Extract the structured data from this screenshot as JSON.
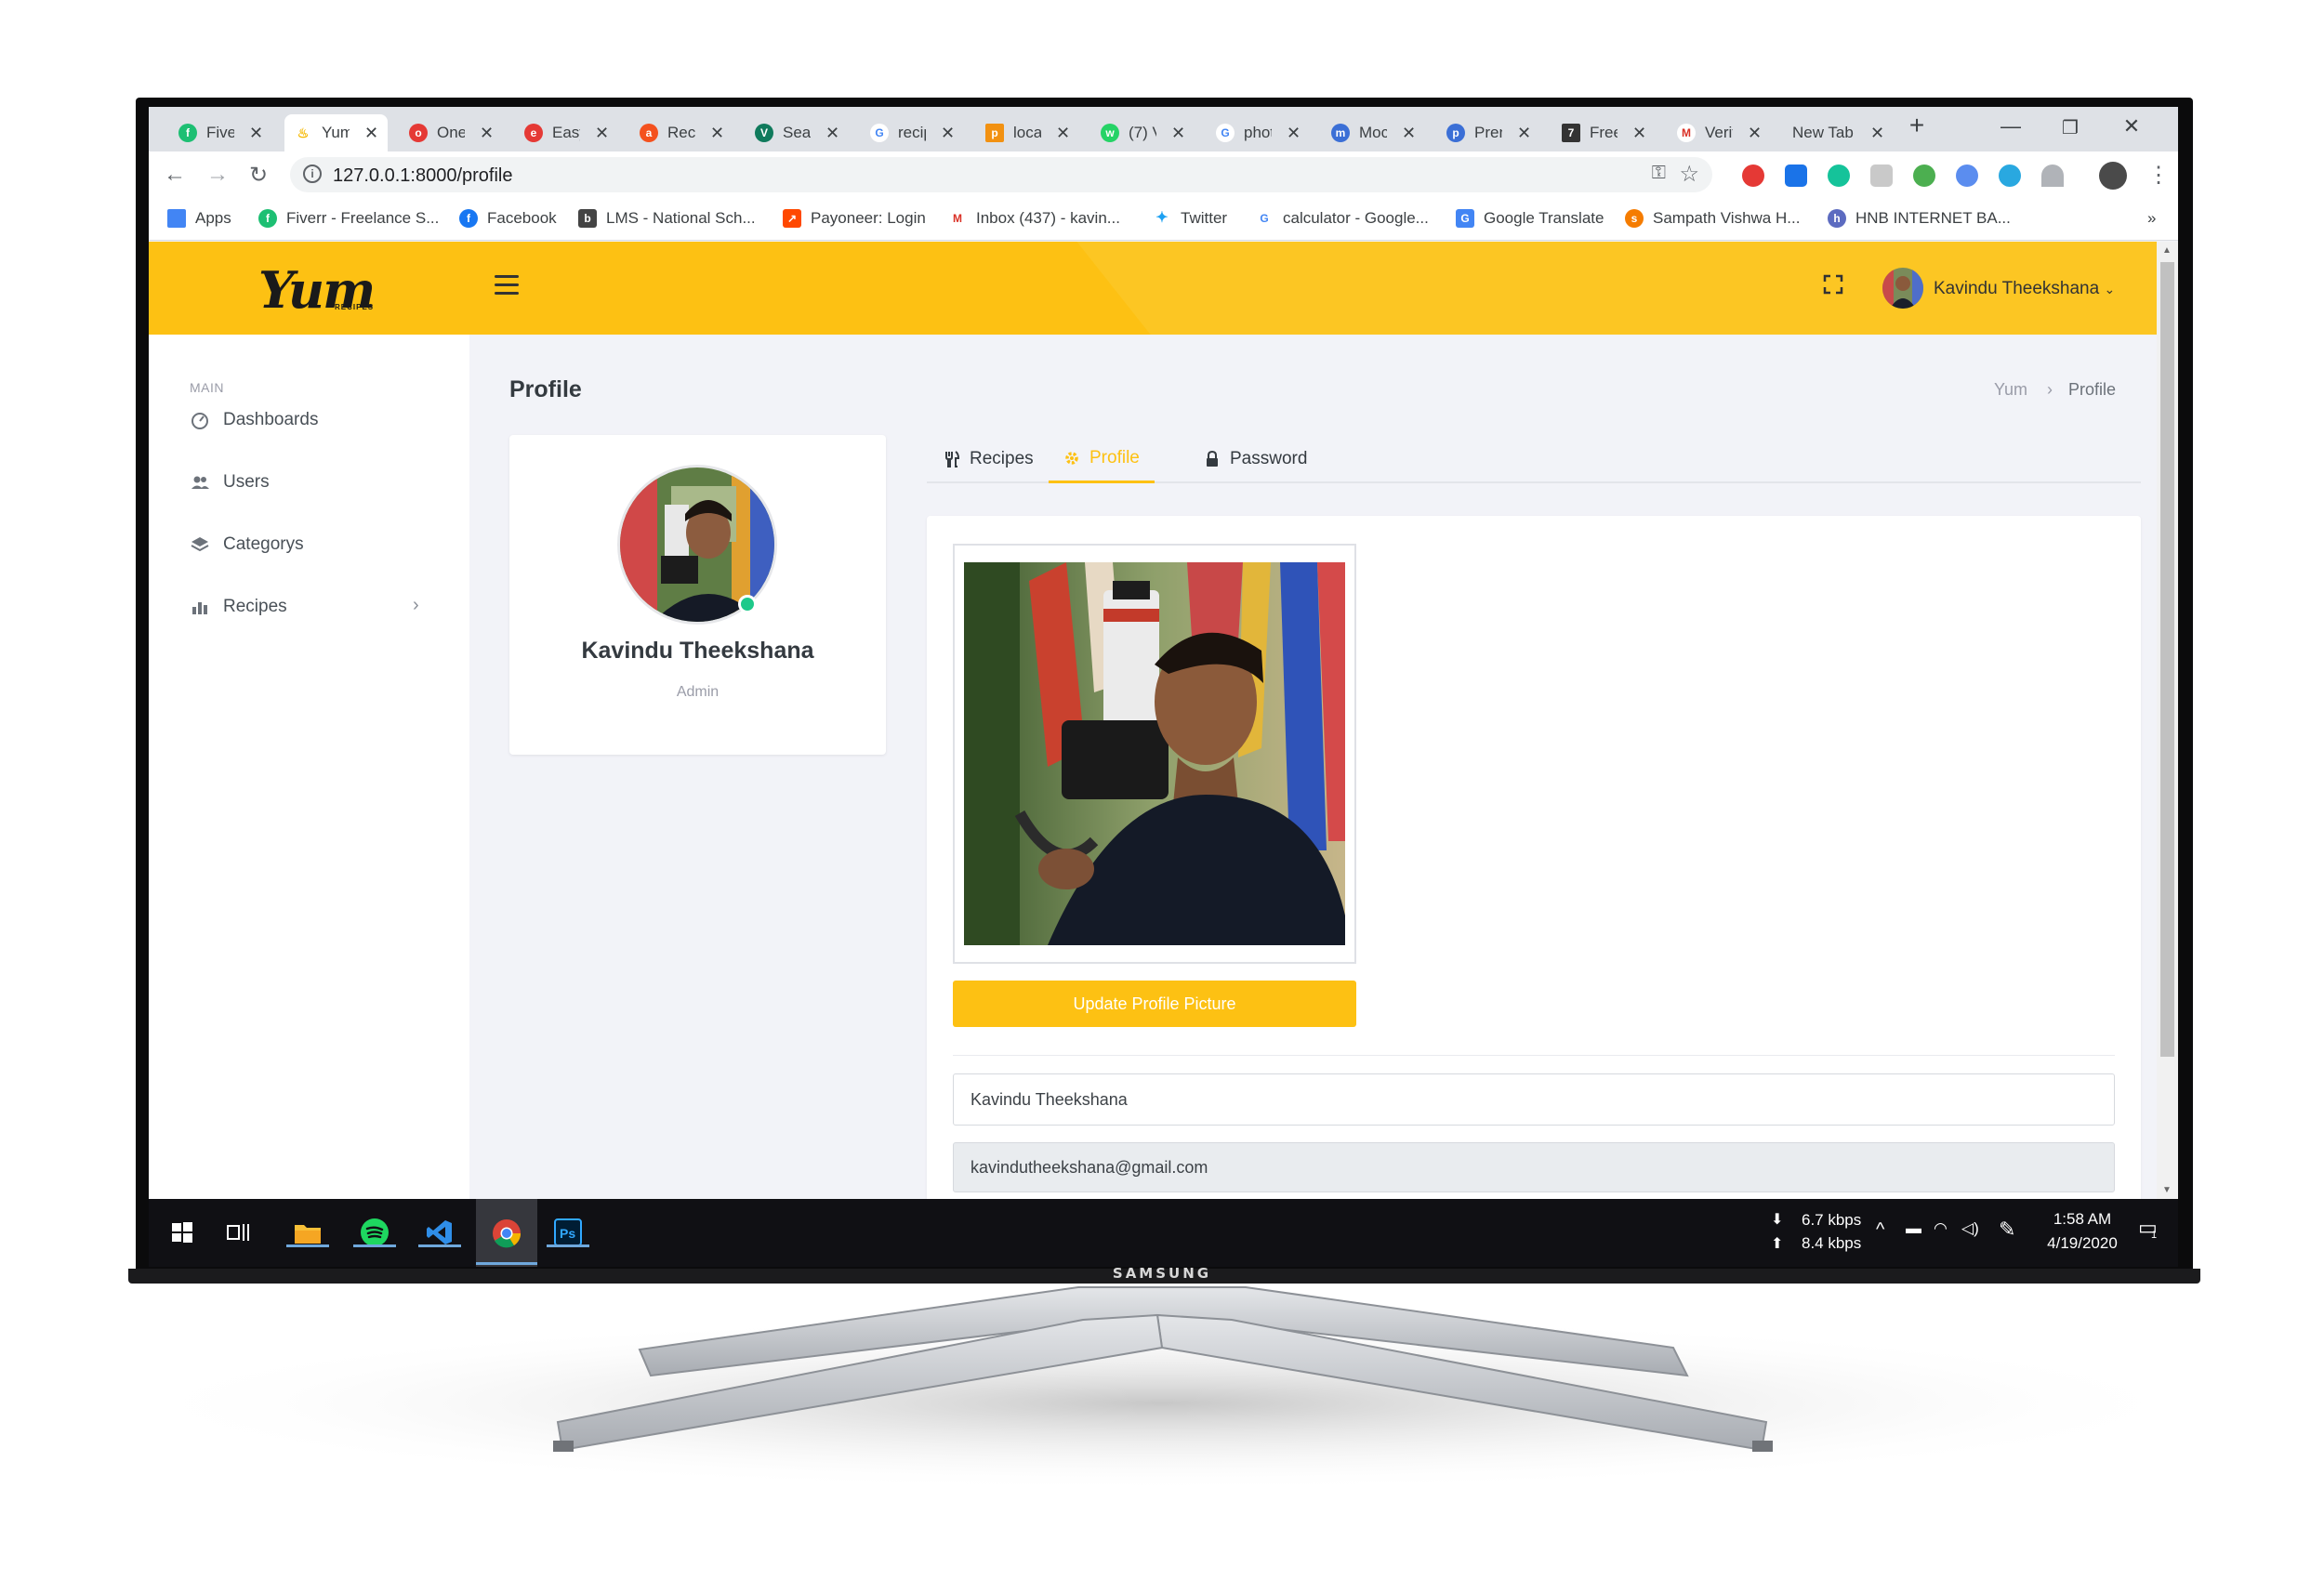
{
  "browser": {
    "tabs": [
      {
        "title": "Fiverr",
        "icon": "fiverr-icon",
        "color": "#1dbf73"
      },
      {
        "title": "Yum",
        "icon": "yum-icon",
        "color": "#f5b800"
      },
      {
        "title": "One",
        "icon": "one-icon",
        "color": "#e53935"
      },
      {
        "title": "Easy",
        "icon": "easy-icon",
        "color": "#e53935"
      },
      {
        "title": "Reci",
        "icon": "recipe-icon",
        "color": "#f4511e"
      },
      {
        "title": "Sear",
        "icon": "search-v-icon",
        "color": "#0f7a5c"
      },
      {
        "title": "recip",
        "icon": "google-icon",
        "color": "#4285f4"
      },
      {
        "title": "local",
        "icon": "pma-icon",
        "color": "#f29111"
      },
      {
        "title": "(7) V",
        "icon": "whatsapp-icon",
        "color": "#25d366"
      },
      {
        "title": "phot",
        "icon": "google-icon",
        "color": "#4285f4"
      },
      {
        "title": "Moc",
        "icon": "mockup-icon",
        "color": "#3b6fd6"
      },
      {
        "title": "Pren",
        "icon": "premium-icon",
        "color": "#3b6fd6"
      },
      {
        "title": "Free",
        "icon": "free-icon",
        "color": "#333333"
      },
      {
        "title": "Verif",
        "icon": "gmail-icon",
        "color": "#d93025"
      },
      {
        "title": "New Tab",
        "icon": "",
        "color": ""
      }
    ],
    "url": "127.0.0.1:8000/profile",
    "bookmarks": [
      {
        "label": "Apps",
        "color": "#4285f4"
      },
      {
        "label": "Fiverr - Freelance S...",
        "color": "#1dbf73"
      },
      {
        "label": "Facebook",
        "color": "#1877f2"
      },
      {
        "label": "LMS - National Sch...",
        "color": "#444444"
      },
      {
        "label": "Payoneer: Login",
        "color": "#ff4800"
      },
      {
        "label": "Inbox (437) - kavin...",
        "color": "#d93025"
      },
      {
        "label": "Twitter",
        "color": "#1da1f2"
      },
      {
        "label": "calculator - Google...",
        "color": "#4285f4"
      },
      {
        "label": "Google Translate",
        "color": "#4285f4"
      },
      {
        "label": "Sampath Vishwa H...",
        "color": "#f57c00"
      },
      {
        "label": "HNB INTERNET BA...",
        "color": "#5c6bc0"
      }
    ],
    "bookmarks_more": "»"
  },
  "app": {
    "logo": "Yum",
    "logo_sub": "RECIPES",
    "header_user": "Kavindu Theekshana",
    "accent": "#fdc113",
    "sidebar": {
      "section": "MAIN",
      "items": [
        {
          "label": "Dashboards",
          "icon": "gauge-icon"
        },
        {
          "label": "Users",
          "icon": "users-icon"
        },
        {
          "label": "Categorys",
          "icon": "layers-icon"
        },
        {
          "label": "Recipes",
          "icon": "chart-icon"
        }
      ]
    },
    "page_title": "Profile",
    "breadcrumb": [
      "Yum",
      "Profile"
    ],
    "profile_card": {
      "name": "Kavindu Theekshana",
      "role": "Admin"
    },
    "tabs": [
      {
        "label": "Recipes",
        "icon": "utensils-icon"
      },
      {
        "label": "Profile",
        "icon": "gear-icon",
        "active": true
      },
      {
        "label": "Password",
        "icon": "lock-icon"
      }
    ],
    "update_button": "Update Profile Picture",
    "name_value": "Kavindu Theekshana",
    "email_value": "kavindutheekshana@gmail.com"
  },
  "taskbar": {
    "net_down": "6.7 kbps",
    "net_up": "8.4 kbps",
    "time": "1:58 AM",
    "date": "4/19/2020",
    "notif_count": "1"
  },
  "monitor": {
    "brand": "SAMSUNG"
  }
}
